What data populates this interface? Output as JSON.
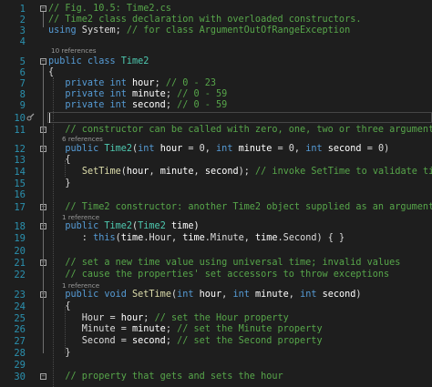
{
  "editor": {
    "lines": [
      {
        "n": "1",
        "tokens": [
          {
            "t": "// Fig. 10.5: Time2.cs",
            "c": "cm"
          }
        ]
      },
      {
        "n": "2",
        "tokens": [
          {
            "t": "// Time2 class declaration with overloaded constructors.",
            "c": "cm"
          }
        ]
      },
      {
        "n": "3",
        "tokens": [
          {
            "t": "using",
            "c": "kw"
          },
          {
            "t": " System; ",
            "c": "pl"
          },
          {
            "t": "// for class ArgumentOutOfRangeException",
            "c": "cm"
          }
        ]
      },
      {
        "n": "4",
        "tokens": []
      },
      {
        "n": "5",
        "lens": "10 references",
        "tokens": [
          {
            "t": "public",
            "c": "kw"
          },
          {
            "t": " ",
            "c": "pl"
          },
          {
            "t": "class",
            "c": "kw"
          },
          {
            "t": " ",
            "c": "pl"
          },
          {
            "t": "Time2",
            "c": "ty"
          }
        ]
      },
      {
        "n": "6",
        "tokens": [
          {
            "t": "{",
            "c": "pl"
          }
        ]
      },
      {
        "n": "7",
        "tokens": [
          {
            "t": "   private int ",
            "c": "kw"
          },
          {
            "t": "hour",
            "c": "id"
          },
          {
            "t": "; ",
            "c": "pl"
          },
          {
            "t": "// 0 - 23",
            "c": "cm"
          }
        ]
      },
      {
        "n": "8",
        "tokens": [
          {
            "t": "   private int ",
            "c": "kw"
          },
          {
            "t": "minute",
            "c": "id"
          },
          {
            "t": "; ",
            "c": "pl"
          },
          {
            "t": "// 0 - 59",
            "c": "cm"
          }
        ]
      },
      {
        "n": "9",
        "tokens": [
          {
            "t": "   private int ",
            "c": "kw"
          },
          {
            "t": "second",
            "c": "id"
          },
          {
            "t": "; ",
            "c": "pl"
          },
          {
            "t": "// 0 - 59",
            "c": "cm"
          }
        ]
      },
      {
        "n": "10",
        "tokens": []
      },
      {
        "n": "11",
        "tokens": [
          {
            "t": "   // constructor can be called with zero, one, two or three arguments",
            "c": "cm"
          }
        ]
      },
      {
        "n": "12",
        "lens": "6 references",
        "tokens": [
          {
            "t": "   public ",
            "c": "kw"
          },
          {
            "t": "Time2",
            "c": "ty"
          },
          {
            "t": "(",
            "c": "pl"
          },
          {
            "t": "int",
            "c": "kw"
          },
          {
            "t": " hour ",
            "c": "id"
          },
          {
            "t": "= 0, ",
            "c": "pl"
          },
          {
            "t": "int",
            "c": "kw"
          },
          {
            "t": " minute ",
            "c": "id"
          },
          {
            "t": "= 0, ",
            "c": "pl"
          },
          {
            "t": "int",
            "c": "kw"
          },
          {
            "t": " second ",
            "c": "id"
          },
          {
            "t": "= 0)",
            "c": "pl"
          }
        ]
      },
      {
        "n": "13",
        "tokens": [
          {
            "t": "   {",
            "c": "pl"
          }
        ]
      },
      {
        "n": "14",
        "tokens": [
          {
            "t": "      ",
            "c": "pl"
          },
          {
            "t": "SetTime",
            "c": "fn"
          },
          {
            "t": "(",
            "c": "pl"
          },
          {
            "t": "hour",
            "c": "id"
          },
          {
            "t": ", ",
            "c": "pl"
          },
          {
            "t": "minute",
            "c": "id"
          },
          {
            "t": ", ",
            "c": "pl"
          },
          {
            "t": "second",
            "c": "id"
          },
          {
            "t": "); ",
            "c": "pl"
          },
          {
            "t": "// invoke SetTime to validate time",
            "c": "cm"
          }
        ]
      },
      {
        "n": "15",
        "tokens": [
          {
            "t": "   }",
            "c": "pl"
          }
        ]
      },
      {
        "n": "16",
        "tokens": []
      },
      {
        "n": "17",
        "tokens": [
          {
            "t": "   // Time2 constructor: another Time2 object supplied as an argument",
            "c": "cm"
          }
        ]
      },
      {
        "n": "18",
        "lens": "1 reference",
        "tokens": [
          {
            "t": "   public ",
            "c": "kw"
          },
          {
            "t": "Time2",
            "c": "ty"
          },
          {
            "t": "(",
            "c": "pl"
          },
          {
            "t": "Time2",
            "c": "ty"
          },
          {
            "t": " time)",
            "c": "id"
          }
        ]
      },
      {
        "n": "19",
        "tokens": [
          {
            "t": "      : ",
            "c": "pl"
          },
          {
            "t": "this",
            "c": "kw"
          },
          {
            "t": "(",
            "c": "pl"
          },
          {
            "t": "time",
            "c": "id"
          },
          {
            "t": ".Hour, ",
            "c": "pl"
          },
          {
            "t": "time",
            "c": "id"
          },
          {
            "t": ".Minute, ",
            "c": "pl"
          },
          {
            "t": "time",
            "c": "id"
          },
          {
            "t": ".Second) { }",
            "c": "pl"
          }
        ]
      },
      {
        "n": "20",
        "tokens": []
      },
      {
        "n": "21",
        "tokens": [
          {
            "t": "   // set a new time value using universal time; invalid values",
            "c": "cm"
          }
        ]
      },
      {
        "n": "22",
        "tokens": [
          {
            "t": "   // cause the properties' set accessors to throw exceptions",
            "c": "cm"
          }
        ]
      },
      {
        "n": "23",
        "lens": "1 reference",
        "tokens": [
          {
            "t": "   public void ",
            "c": "kw"
          },
          {
            "t": "SetTime",
            "c": "fn"
          },
          {
            "t": "(",
            "c": "pl"
          },
          {
            "t": "int",
            "c": "kw"
          },
          {
            "t": " hour",
            "c": "id"
          },
          {
            "t": ", ",
            "c": "pl"
          },
          {
            "t": "int",
            "c": "kw"
          },
          {
            "t": " minute",
            "c": "id"
          },
          {
            "t": ", ",
            "c": "pl"
          },
          {
            "t": "int",
            "c": "kw"
          },
          {
            "t": " second",
            "c": "id"
          },
          {
            "t": ")",
            "c": "pl"
          }
        ]
      },
      {
        "n": "24",
        "tokens": [
          {
            "t": "   {",
            "c": "pl"
          }
        ]
      },
      {
        "n": "25",
        "tokens": [
          {
            "t": "      Hour = ",
            "c": "pl"
          },
          {
            "t": "hour",
            "c": "id"
          },
          {
            "t": "; ",
            "c": "pl"
          },
          {
            "t": "// set the Hour property",
            "c": "cm"
          }
        ]
      },
      {
        "n": "26",
        "tokens": [
          {
            "t": "      Minute = ",
            "c": "pl"
          },
          {
            "t": "minute",
            "c": "id"
          },
          {
            "t": "; ",
            "c": "pl"
          },
          {
            "t": "// set the Minute property",
            "c": "cm"
          }
        ]
      },
      {
        "n": "27",
        "tokens": [
          {
            "t": "      Second = ",
            "c": "pl"
          },
          {
            "t": "second",
            "c": "id"
          },
          {
            "t": "; ",
            "c": "pl"
          },
          {
            "t": "// set the Second property",
            "c": "cm"
          }
        ]
      },
      {
        "n": "28",
        "tokens": [
          {
            "t": "   }",
            "c": "pl"
          }
        ]
      },
      {
        "n": "29",
        "tokens": []
      },
      {
        "n": "30",
        "tokens": [
          {
            "t": "   // property that gets and sets the hour",
            "c": "cm"
          }
        ]
      }
    ]
  },
  "colors": {
    "background": "#1e1e1e",
    "line_number": "#2b91af",
    "keyword": "#569cd6",
    "comment": "#57a64a",
    "type": "#4ec9b0",
    "method": "#dcdcaa",
    "identifier": "#ffffff",
    "plain": "#dcdcdc",
    "codelens": "#999999"
  },
  "icons": {
    "gutter_line_10": "quick-actions-lightbulb-icon",
    "fold": "collapse-minus-icon"
  },
  "current_line": "10"
}
